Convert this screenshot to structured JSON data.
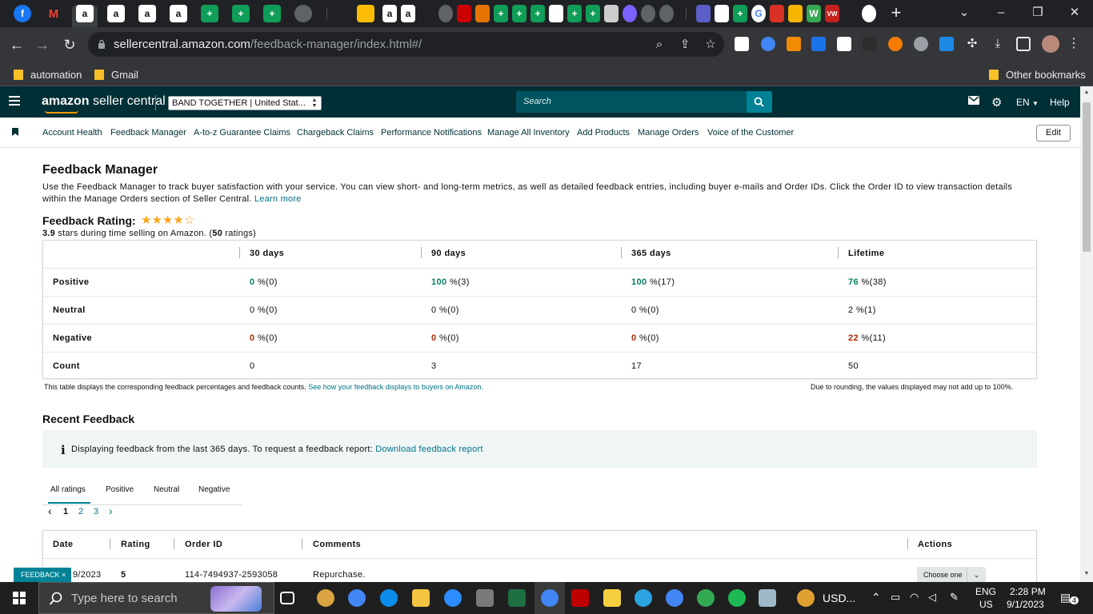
{
  "browser": {
    "url_domain": "sellercentral.amazon.com",
    "url_path": "/feedback-manager/index.html#/",
    "bookmarks": [
      {
        "label": "automation"
      },
      {
        "label": "Gmail"
      },
      {
        "label": "Other bookmarks"
      }
    ]
  },
  "header": {
    "logo_part1": "amazon",
    "logo_part2": " seller central",
    "account_selector": "BAND TOGETHER | United Stat...",
    "search_placeholder": "Search",
    "language": "EN",
    "help": "Help"
  },
  "subnav": {
    "items": [
      "Account Health",
      "Feedback Manager",
      "A-to-z Guarantee Claims",
      "Chargeback Claims",
      "Performance Notifications",
      "Manage All Inventory",
      "Add Products",
      "Manage Orders",
      "Voice of the Customer"
    ],
    "edit": "Edit"
  },
  "page": {
    "title": "Feedback Manager",
    "intro": "Use the Feedback Manager to track buyer satisfaction with your service. You can view short- and long-term metrics, as well as detailed feedback entries, including buyer e-mails and Order IDs. Click the Order ID to view transaction details within the Manage Orders section of Seller Central.",
    "learn_more": "Learn more",
    "rating_title": "Feedback Rating:",
    "rating_stars": 3.9,
    "rating_value": "3.9",
    "rating_sub_middle": " stars during time selling on Amazon. (",
    "rating_count": "50",
    "rating_sub_end": " ratings)"
  },
  "feedback_table": {
    "columns": [
      "30 days",
      "90 days",
      "365 days",
      "Lifetime"
    ],
    "rows": [
      {
        "label": "Positive",
        "cells": [
          {
            "num": "0",
            "rest": " %(0)",
            "tone": "green"
          },
          {
            "num": "100",
            "rest": " %(3)",
            "tone": "green"
          },
          {
            "num": "100",
            "rest": " %(17)",
            "tone": "green"
          },
          {
            "num": "76",
            "rest": " %(38)",
            "tone": "green"
          }
        ]
      },
      {
        "label": "Neutral",
        "cells": [
          {
            "num": "0",
            "rest": " %(0)",
            "tone": ""
          },
          {
            "num": "0",
            "rest": " %(0)",
            "tone": ""
          },
          {
            "num": "0",
            "rest": " %(0)",
            "tone": ""
          },
          {
            "num": "2",
            "rest": " %(1)",
            "tone": ""
          }
        ]
      },
      {
        "label": "Negative",
        "cells": [
          {
            "num": "0",
            "rest": " %(0)",
            "tone": "red"
          },
          {
            "num": "0",
            "rest": " %(0)",
            "tone": "red"
          },
          {
            "num": "0",
            "rest": " %(0)",
            "tone": "red"
          },
          {
            "num": "22",
            "rest": " %(11)",
            "tone": "red"
          }
        ]
      },
      {
        "label": "Count",
        "cells": [
          {
            "num": "",
            "rest": "0",
            "tone": ""
          },
          {
            "num": "",
            "rest": "3",
            "tone": ""
          },
          {
            "num": "",
            "rest": "17",
            "tone": ""
          },
          {
            "num": "",
            "rest": "50",
            "tone": ""
          }
        ]
      }
    ],
    "note": "This table displays the corresponding feedback percentages and feedback counts.",
    "note_link": "See how your feedback displays to buyers on Amazon.",
    "rounding_note": "Due to rounding, the values displayed may not add up to 100%."
  },
  "recent": {
    "title": "Recent Feedback",
    "info_icon": "i",
    "info_text": "Displaying feedback from the last 365 days. To request a feedback report:",
    "info_link": "Download feedback report",
    "tabs": [
      "All ratings",
      "Positive",
      "Neutral",
      "Negative"
    ],
    "pager": {
      "prev": "‹",
      "pages": [
        "1",
        "2",
        "3"
      ],
      "next": "›"
    },
    "columns": [
      "Date",
      "Rating",
      "Order ID",
      "Comments",
      "Actions"
    ],
    "row": {
      "date": "9/2023",
      "rating": "5",
      "order_id": "114-7494937-2593058",
      "comment": "Repurchase.",
      "action": "Choose one"
    }
  },
  "feedback_tab": "FEEDBACK ×",
  "taskbar": {
    "search_placeholder": "Type here to search",
    "usd": "USD...",
    "lang1": "ENG",
    "lang2": "US",
    "time": "2:28 PM",
    "date": "9/1/2023",
    "notifications": "4"
  },
  "colors": {
    "header_bg": "#002f36",
    "accent": "#008296",
    "link": "#007185",
    "positive": "#067d62",
    "negative": "#b12704",
    "star": "#ffa41c"
  }
}
